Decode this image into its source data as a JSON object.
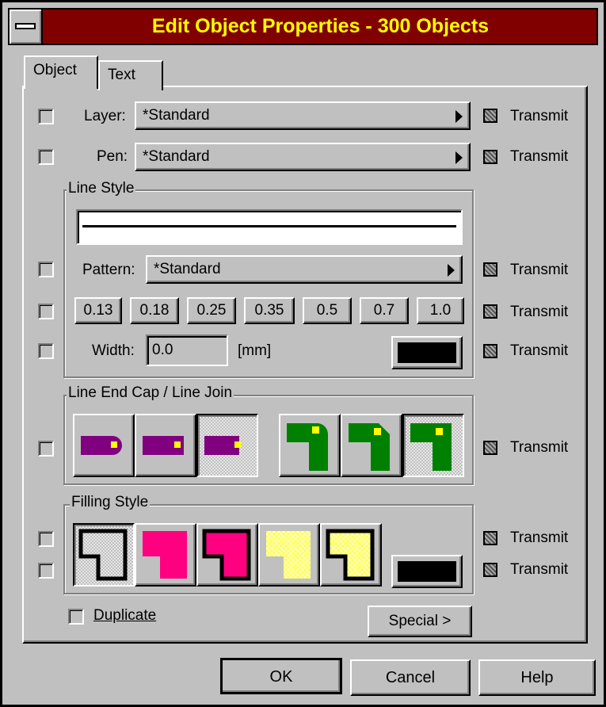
{
  "title": "Edit Object Properties - 300 Objects",
  "tabs": [
    {
      "label": "Object"
    },
    {
      "label": "Text"
    }
  ],
  "rows": {
    "layer": {
      "label": "Layer:",
      "value": "*Standard",
      "transmit": "Transmit"
    },
    "pen": {
      "label": "Pen:",
      "value": "*Standard",
      "transmit": "Transmit"
    }
  },
  "line_style": {
    "title": "Line Style",
    "pattern_label": "Pattern:",
    "pattern_value": "*Standard",
    "transmit": "Transmit",
    "widths": [
      "0.13",
      "0.18",
      "0.25",
      "0.35",
      "0.5",
      "0.7",
      "1.0"
    ],
    "width_label": "Width:",
    "width_value": "0.0",
    "width_unit": "[mm]"
  },
  "line_end": {
    "title": "Line End Cap / Line Join",
    "transmit": "Transmit"
  },
  "filling": {
    "title": "Filling Style",
    "transmit_1": "Transmit",
    "transmit_2": "Transmit"
  },
  "duplicate_label": "Duplicate",
  "special_label": "Special >",
  "buttons": {
    "ok": "OK",
    "cancel": "Cancel",
    "help": "Help"
  },
  "colors": {
    "titlebar": "#800000",
    "title_text": "#ffff00",
    "cap": "#800080",
    "join": "#008000",
    "fill_pink": "#ff0080",
    "fill_yellow": "#ffffc0",
    "color_swatch": "#000000"
  }
}
